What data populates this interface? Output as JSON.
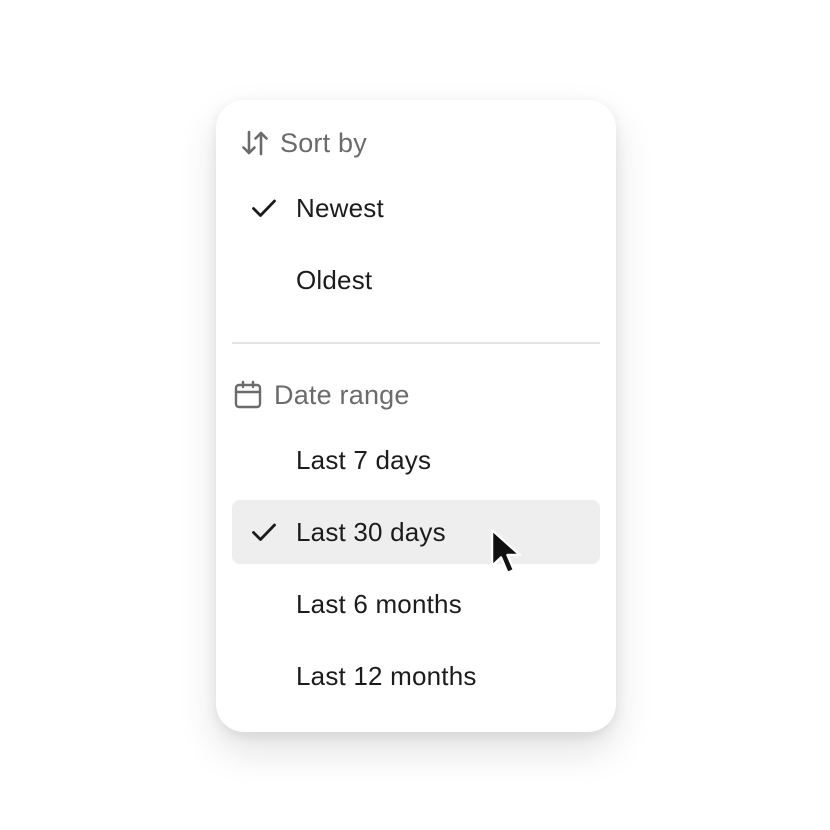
{
  "sort": {
    "header": "Sort by",
    "header_icon": "sort-arrows-icon",
    "items": [
      {
        "label": "Newest",
        "checked": true
      },
      {
        "label": "Oldest",
        "checked": false
      }
    ]
  },
  "date_range": {
    "header": "Date range",
    "header_icon": "calendar-icon",
    "items": [
      {
        "label": "Last 7 days",
        "checked": false
      },
      {
        "label": "Last 30 days",
        "checked": true,
        "hovered": true
      },
      {
        "label": "Last 6 months",
        "checked": false
      },
      {
        "label": "Last 12 months",
        "checked": false
      }
    ]
  },
  "colors": {
    "text": "#1c1c1c",
    "header_text": "#6b6b6b",
    "hover_bg": "#eeeeee",
    "divider": "#e4e4e4"
  }
}
